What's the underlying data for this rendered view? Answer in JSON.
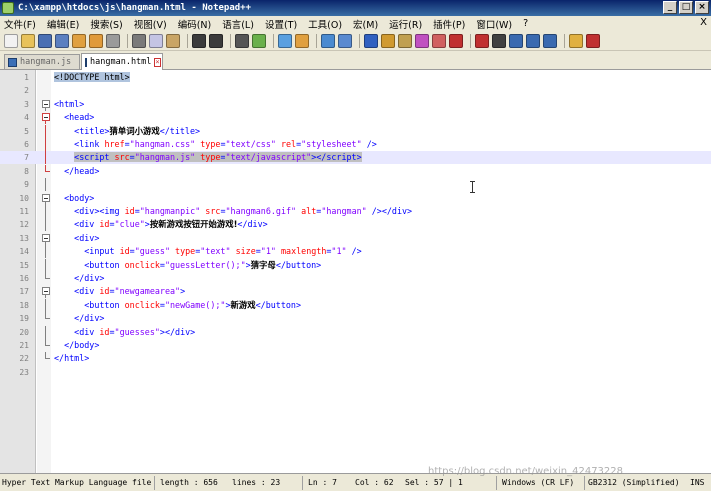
{
  "window": {
    "title": "C:\\xampp\\htdocs\\js\\hangman.html - Notepad++",
    "minimize": "_",
    "maximize": "□",
    "close": "×"
  },
  "menu": {
    "items": [
      "文件(F)",
      "编辑(E)",
      "搜索(S)",
      "视图(V)",
      "编码(N)",
      "语言(L)",
      "设置(T)",
      "工具(O)",
      "宏(M)",
      "运行(R)",
      "插件(P)",
      "窗口(W)",
      "?"
    ],
    "close_doc": "X"
  },
  "toolbar": {
    "icons": [
      {
        "name": "new-file-icon",
        "color": "#f2f2f2"
      },
      {
        "name": "open-file-icon",
        "color": "#e8c25a"
      },
      {
        "name": "save-icon",
        "color": "#4a6fb3"
      },
      {
        "name": "save-all-icon",
        "color": "#5b7fc0"
      },
      {
        "name": "close-icon",
        "color": "#e0a040"
      },
      {
        "name": "close-all-icon",
        "color": "#e09a3a"
      },
      {
        "name": "print-icon",
        "color": "#9a9a9a"
      },
      {
        "name": "cut-icon",
        "color": "#7a7a7a"
      },
      {
        "name": "copy-icon",
        "color": "#c4c4e4"
      },
      {
        "name": "paste-icon",
        "color": "#c9a565"
      },
      {
        "name": "undo-icon",
        "color": "#3b3b3b"
      },
      {
        "name": "redo-icon",
        "color": "#3b3b3b"
      },
      {
        "name": "find-icon",
        "color": "#555555"
      },
      {
        "name": "replace-icon",
        "color": "#6ab04c"
      },
      {
        "name": "zoom-in-icon",
        "color": "#5aa0e0"
      },
      {
        "name": "zoom-out-icon",
        "color": "#e0a040"
      },
      {
        "name": "sync-v-icon",
        "color": "#4a8ad0"
      },
      {
        "name": "sync-h-icon",
        "color": "#5a8ad0"
      },
      {
        "name": "word-wrap-icon",
        "color": "#3060c0"
      },
      {
        "name": "show-all-chars-icon",
        "color": "#d09a30"
      },
      {
        "name": "indent-guide-icon",
        "color": "#c0a050"
      },
      {
        "name": "lang-icon",
        "color": "#c050c0"
      },
      {
        "name": "doc-map-icon",
        "color": "#d06060"
      },
      {
        "name": "monitor-icon",
        "color": "#c03030"
      },
      {
        "name": "record-macro-icon",
        "color": "#c03030"
      },
      {
        "name": "stop-macro-icon",
        "color": "#404040"
      },
      {
        "name": "play-macro-icon",
        "color": "#3a6ab0"
      },
      {
        "name": "run-macro-icon",
        "color": "#3a6ab0"
      },
      {
        "name": "save-macro-icon",
        "color": "#3a6ab0"
      },
      {
        "name": "folder-icon",
        "color": "#e0b040"
      },
      {
        "name": "spellcheck-icon",
        "color": "#c03030"
      }
    ]
  },
  "tabs": [
    {
      "label": "hangman.js",
      "active": false
    },
    {
      "label": "hangman.html",
      "active": true
    }
  ],
  "editor": {
    "lines": [
      {
        "n": "1",
        "fold": "none",
        "html": "<span class=\"dt\">&lt;!DOCTYPE html&gt;</span>"
      },
      {
        "n": "2",
        "fold": "none",
        "html": ""
      },
      {
        "n": "3",
        "fold": "open",
        "html": "<span class=\"t\">&lt;html&gt;</span>"
      },
      {
        "n": "4",
        "fold": "open-red",
        "html": "  <span class=\"t\">&lt;head&gt;</span>"
      },
      {
        "n": "5",
        "fold": "vline",
        "html": "    <span class=\"t\">&lt;title&gt;</span><span class=\"cn\">猜单词小游戏</span><span class=\"t\">&lt;/title&gt;</span>"
      },
      {
        "n": "6",
        "fold": "vline",
        "html": "    <span class=\"t\">&lt;link </span><span class=\"a\">href</span><span class=\"t\">=</span><span class=\"v\">\"hangman.css\"</span> <span class=\"a\">type</span><span class=\"t\">=</span><span class=\"v\">\"text/css\"</span> <span class=\"a\">rel</span><span class=\"t\">=</span><span class=\"v\">\"stylesheet\"</span> <span class=\"t\">/&gt;</span>"
      },
      {
        "n": "7",
        "fold": "vline",
        "html": "    <span class=\"t hl\">&lt;script</span><span class=\"hl\"> </span><span class=\"a hl\">src</span><span class=\"t hl\">=</span><span class=\"v hl\">\"hangman.js\"</span><span class=\"hl\"> </span><span class=\"a hl\">type</span><span class=\"t hl\">=</span><span class=\"v hl\">\"text/javascript\"</span><span class=\"t hl\">&gt;&lt;/script&gt;</span>",
        "current": true
      },
      {
        "n": "8",
        "fold": "end-red",
        "html": "  <span class=\"t\">&lt;/head&gt;</span>"
      },
      {
        "n": "9",
        "fold": "gvline",
        "html": ""
      },
      {
        "n": "10",
        "fold": "open",
        "html": "  <span class=\"t\">&lt;body&gt;</span>"
      },
      {
        "n": "11",
        "fold": "gvline",
        "html": "    <span class=\"t\">&lt;div&gt;&lt;img </span><span class=\"a\">id</span><span class=\"t\">=</span><span class=\"v\">\"hangmanpic\"</span> <span class=\"a\">src</span><span class=\"t\">=</span><span class=\"v\">\"hangman6.gif\"</span> <span class=\"a\">alt</span><span class=\"t\">=</span><span class=\"v\">\"hangman\"</span> <span class=\"t\">/&gt;&lt;/div&gt;</span>"
      },
      {
        "n": "12",
        "fold": "gvline",
        "html": "    <span class=\"t\">&lt;div </span><span class=\"a\">id</span><span class=\"t\">=</span><span class=\"v\">\"clue\"</span><span class=\"t\">&gt;</span><span class=\"cn\">按新游戏按钮开始游戏!</span><span class=\"t\">&lt;/div&gt;</span>"
      },
      {
        "n": "13",
        "fold": "open",
        "html": "    <span class=\"t\">&lt;div&gt;</span>"
      },
      {
        "n": "14",
        "fold": "gvline",
        "html": "      <span class=\"t\">&lt;input </span><span class=\"a\">id</span><span class=\"t\">=</span><span class=\"v\">\"guess\"</span> <span class=\"a\">type</span><span class=\"t\">=</span><span class=\"v\">\"text\"</span> <span class=\"a\">size</span><span class=\"t\">=</span><span class=\"v\">\"1\"</span> <span class=\"a\">maxlength</span><span class=\"t\">=</span><span class=\"v\">\"1\"</span> <span class=\"t\">/&gt;</span>"
      },
      {
        "n": "15",
        "fold": "gvline",
        "html": "      <span class=\"t\">&lt;button </span><span class=\"a\">onclick</span><span class=\"t\">=</span><span class=\"v\">\"guessLetter();\"</span><span class=\"t\">&gt;</span><span class=\"cn\">猜字母</span><span class=\"t\">&lt;/button&gt;</span>"
      },
      {
        "n": "16",
        "fold": "gend",
        "html": "    <span class=\"t\">&lt;/div&gt;</span>"
      },
      {
        "n": "17",
        "fold": "open",
        "html": "    <span class=\"t\">&lt;div </span><span class=\"a\">id</span><span class=\"t\">=</span><span class=\"v\">\"newgamearea\"</span><span class=\"t\">&gt;</span>"
      },
      {
        "n": "18",
        "fold": "gvline",
        "html": "      <span class=\"t\">&lt;button </span><span class=\"a\">onclick</span><span class=\"t\">=</span><span class=\"v\">\"newGame();\"</span><span class=\"t\">&gt;</span><span class=\"cn\">新游戏</span><span class=\"t\">&lt;/button&gt;</span>"
      },
      {
        "n": "19",
        "fold": "gend",
        "html": "    <span class=\"t\">&lt;/div&gt;</span>"
      },
      {
        "n": "20",
        "fold": "gvline",
        "html": "    <span class=\"t\">&lt;div </span><span class=\"a\">id</span><span class=\"t\">=</span><span class=\"v\">\"guesses\"</span><span class=\"t\">&gt;&lt;/div&gt;</span>"
      },
      {
        "n": "21",
        "fold": "gend",
        "html": "  <span class=\"t\">&lt;/body&gt;</span>"
      },
      {
        "n": "22",
        "fold": "gend",
        "html": "<span class=\"t\">&lt;/html&gt;</span>"
      },
      {
        "n": "23",
        "fold": "none",
        "html": ""
      }
    ]
  },
  "status": {
    "file_type": "Hyper Text Markup Language file",
    "length": "length : 656",
    "lines": "lines : 23",
    "ln": "Ln : 7",
    "col": "Col : 62",
    "sel": "Sel : 57 | 1",
    "eol": "Windows (CR LF)",
    "encoding": "GB2312 (Simplified)",
    "mode": "INS"
  },
  "watermark": "https://blog.csdn.net/weixin_42473228"
}
